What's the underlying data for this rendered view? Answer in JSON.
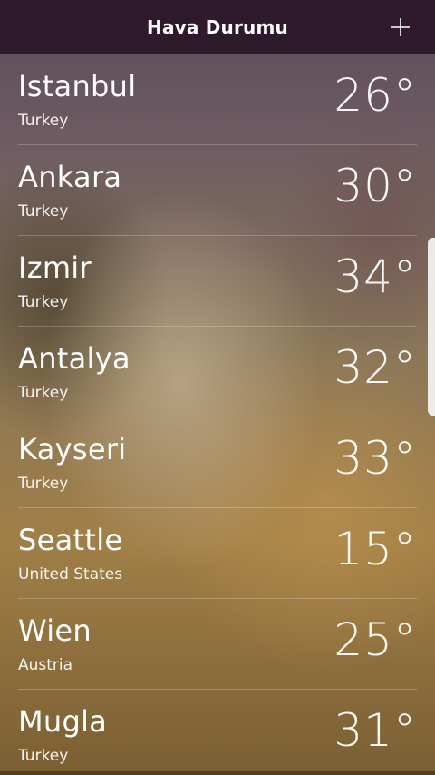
{
  "header": {
    "title": "Hava Durumu",
    "add_icon": "plus-icon"
  },
  "cities": [
    {
      "name": "Istanbul",
      "country": "Turkey",
      "temp": "26°"
    },
    {
      "name": "Ankara",
      "country": "Turkey",
      "temp": "30°"
    },
    {
      "name": "Izmir",
      "country": "Turkey",
      "temp": "34°"
    },
    {
      "name": "Antalya",
      "country": "Turkey",
      "temp": "32°"
    },
    {
      "name": "Kayseri",
      "country": "Turkey",
      "temp": "33°"
    },
    {
      "name": "Seattle",
      "country": "United States",
      "temp": "15°"
    },
    {
      "name": "Wien",
      "country": "Austria",
      "temp": "25°"
    },
    {
      "name": "Mugla",
      "country": "Turkey",
      "temp": "31°"
    }
  ],
  "colors": {
    "header_bg": "#2e1a2b",
    "text": "#ffffff"
  }
}
